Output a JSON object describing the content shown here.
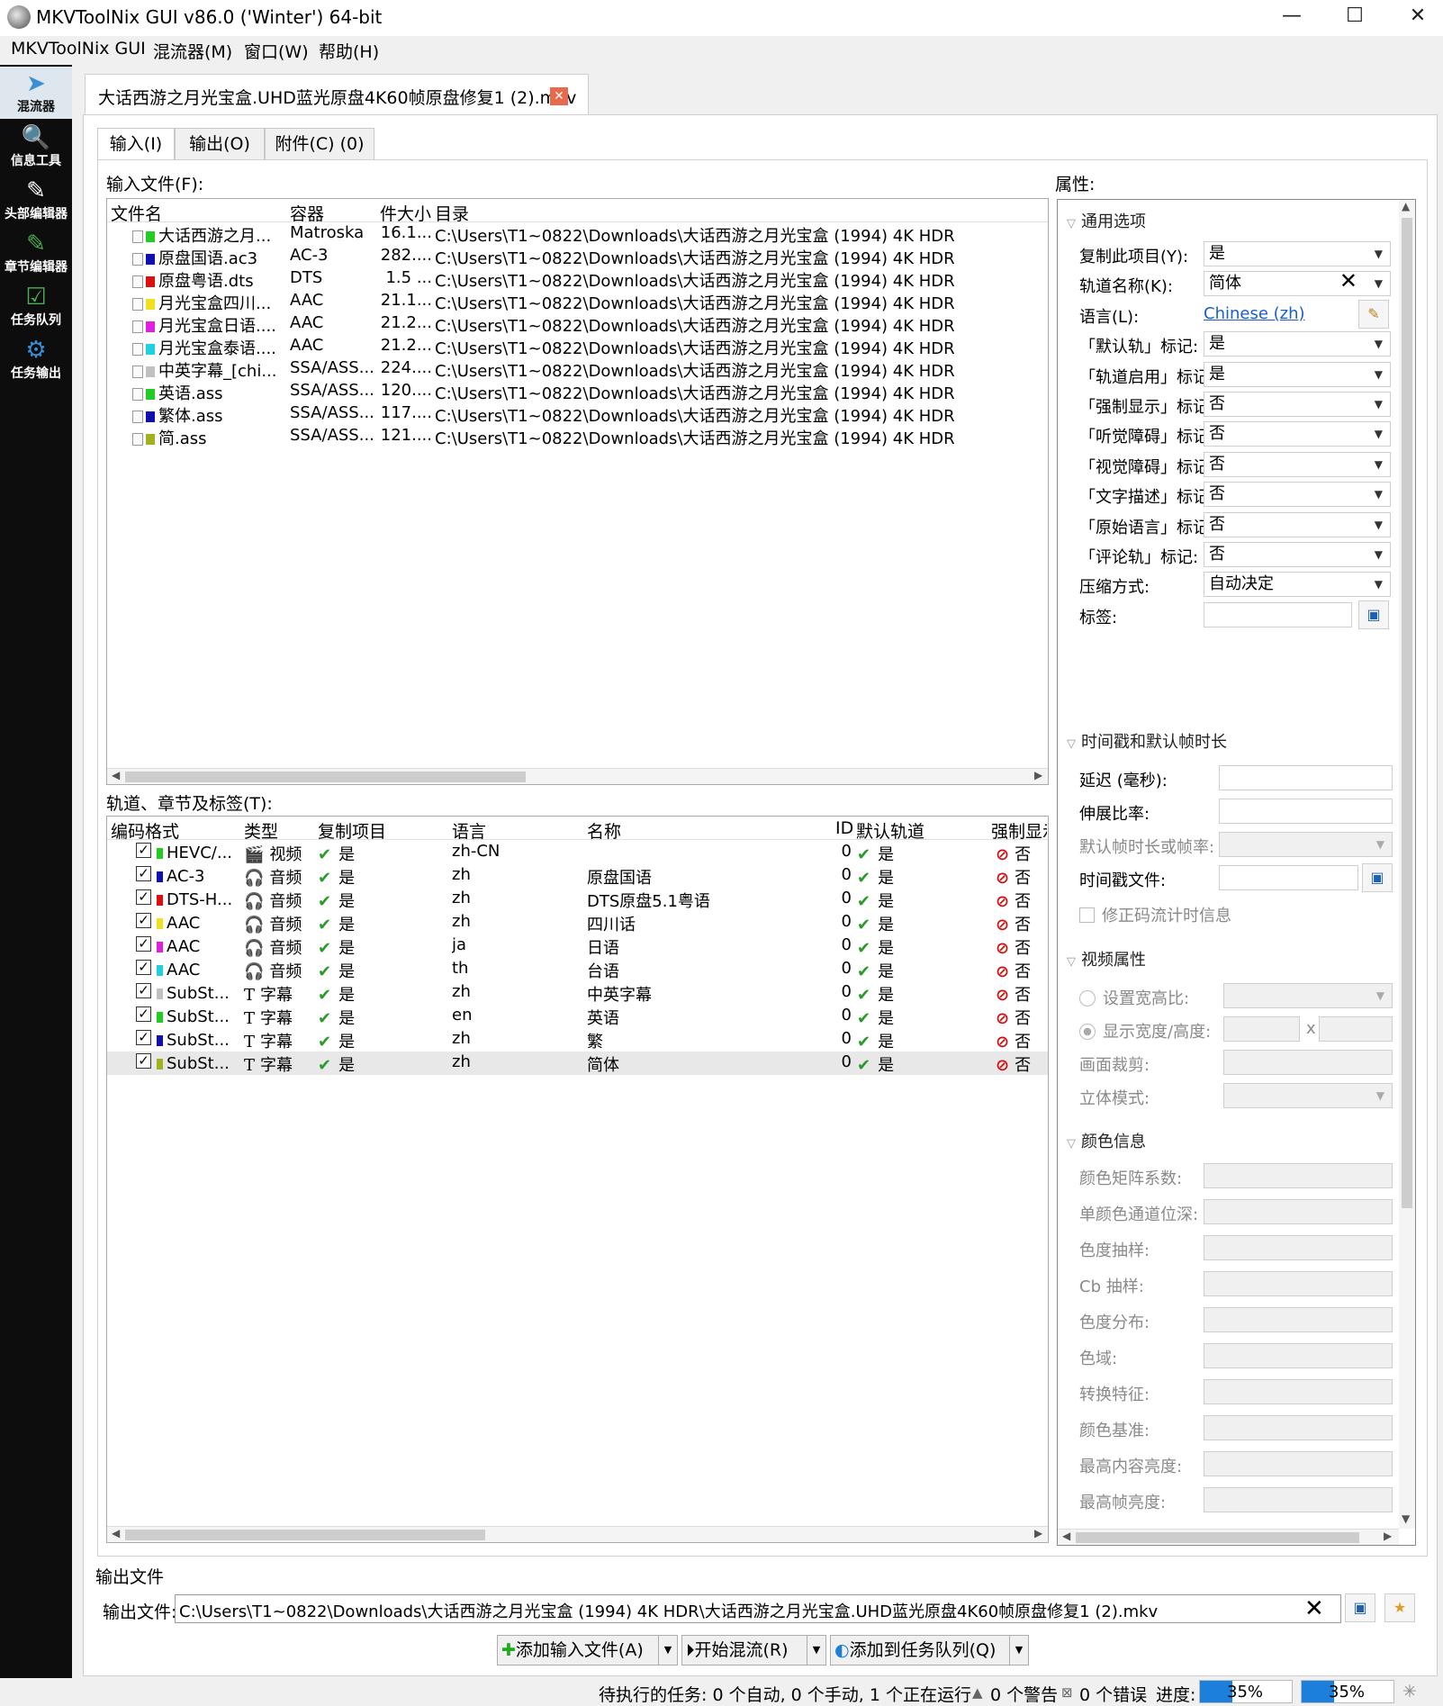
{
  "window": {
    "title": "MKVToolNix GUI v86.0 ('Winter') 64-bit",
    "min_glyph": "—",
    "max_glyph": "☐",
    "close_glyph": "✕"
  },
  "menu": [
    "MKVToolNix GUI",
    "混流器(M)",
    "窗口(W)",
    "帮助(H)"
  ],
  "sidebar": [
    {
      "label": "混流器",
      "icon": "mixer-icon"
    },
    {
      "label": "信息工具",
      "icon": "info-tool-icon"
    },
    {
      "label": "头部编辑器",
      "icon": "header-editor-icon"
    },
    {
      "label": "章节编辑器",
      "icon": "chapter-editor-icon"
    },
    {
      "label": "任务队列",
      "icon": "job-queue-icon"
    },
    {
      "label": "任务输出",
      "icon": "job-output-icon"
    }
  ],
  "doc_tab": {
    "label": "大话西游之月光宝盒.UHD蓝光原盘4K60帧原盘修复1 (2).mkv",
    "close": "✕"
  },
  "subtabs": [
    "输入(I)",
    "输出(O)",
    "附件(C) (0)"
  ],
  "input_files": {
    "label": "输入文件(F):",
    "headers": [
      "文件名",
      "容器",
      "件大小",
      "目录"
    ],
    "rows": [
      {
        "name": "大话西游之月...",
        "container": "Matroska",
        "size": "16.1...",
        "dir": "C:\\Users\\T1~0822\\Downloads\\大话西游之月光宝盒 (1994) 4K HDR",
        "color": "#22cc22"
      },
      {
        "name": "原盘国语.ac3",
        "container": "AC-3",
        "size": "282....",
        "dir": "C:\\Users\\T1~0822\\Downloads\\大话西游之月光宝盒 (1994) 4K HDR",
        "color": "#1010b0"
      },
      {
        "name": "原盘粤语.dts",
        "container": "DTS",
        "size": "1.5 ...",
        "dir": "C:\\Users\\T1~0822\\Downloads\\大话西游之月光宝盒 (1994) 4K HDR",
        "color": "#dd1010"
      },
      {
        "name": "月光宝盒四川...",
        "container": "AAC",
        "size": "21.1...",
        "dir": "C:\\Users\\T1~0822\\Downloads\\大话西游之月光宝盒 (1994) 4K HDR",
        "color": "#f0e020"
      },
      {
        "name": "月光宝盒日语....",
        "container": "AAC",
        "size": "21.2...",
        "dir": "C:\\Users\\T1~0822\\Downloads\\大话西游之月光宝盒 (1994) 4K HDR",
        "color": "#e020e0"
      },
      {
        "name": "月光宝盒泰语....",
        "container": "AAC",
        "size": "21.2...",
        "dir": "C:\\Users\\T1~0822\\Downloads\\大话西游之月光宝盒 (1994) 4K HDR",
        "color": "#20d0e0"
      },
      {
        "name": "中英字幕_[chi...",
        "container": "SSA/ASS...",
        "size": "224....",
        "dir": "C:\\Users\\T1~0822\\Downloads\\大话西游之月光宝盒 (1994) 4K HDR",
        "color": "#c0c0c0"
      },
      {
        "name": "英语.ass",
        "container": "SSA/ASS...",
        "size": "120....",
        "dir": "C:\\Users\\T1~0822\\Downloads\\大话西游之月光宝盒 (1994) 4K HDR",
        "color": "#22cc22"
      },
      {
        "name": "繁体.ass",
        "container": "SSA/ASS...",
        "size": "117....",
        "dir": "C:\\Users\\T1~0822\\Downloads\\大话西游之月光宝盒 (1994) 4K HDR",
        "color": "#1010b0"
      },
      {
        "name": "简.ass",
        "container": "SSA/ASS...",
        "size": "121....",
        "dir": "C:\\Users\\T1~0822\\Downloads\\大话西游之月光宝盒 (1994) 4K HDR",
        "color": "#a0b020"
      }
    ]
  },
  "tracks": {
    "label": "轨道、章节及标签(T):",
    "headers": [
      "编码格式",
      "类型",
      "复制项目",
      "语言",
      "名称",
      "ID",
      "默认轨道",
      "强制显示"
    ],
    "rows": [
      {
        "codec": "HEVC/...",
        "type": "视频",
        "type_icon": "video-icon",
        "copy": "是",
        "lang": "zh-CN",
        "name": "",
        "id": "0",
        "default": "是",
        "forced": "否",
        "color": "#22cc22"
      },
      {
        "codec": "AC-3",
        "type": "音频",
        "type_icon": "audio-icon",
        "copy": "是",
        "lang": "zh",
        "name": "原盘国语",
        "id": "0",
        "default": "是",
        "forced": "否",
        "color": "#1010b0"
      },
      {
        "codec": "DTS-H...",
        "type": "音频",
        "type_icon": "audio-icon",
        "copy": "是",
        "lang": "zh",
        "name": "DTS原盘5.1粤语",
        "id": "0",
        "default": "是",
        "forced": "否",
        "color": "#dd1010"
      },
      {
        "codec": "AAC",
        "type": "音频",
        "type_icon": "audio-icon",
        "copy": "是",
        "lang": "zh",
        "name": "四川话",
        "id": "0",
        "default": "是",
        "forced": "否",
        "color": "#f0e020"
      },
      {
        "codec": "AAC",
        "type": "音频",
        "type_icon": "audio-icon",
        "copy": "是",
        "lang": "ja",
        "name": "日语",
        "id": "0",
        "default": "是",
        "forced": "否",
        "color": "#e020e0"
      },
      {
        "codec": "AAC",
        "type": "音频",
        "type_icon": "audio-icon",
        "copy": "是",
        "lang": "th",
        "name": "台语",
        "id": "0",
        "default": "是",
        "forced": "否",
        "color": "#20d0e0"
      },
      {
        "codec": "SubSt...",
        "type": "字幕",
        "type_icon": "subtitle-icon",
        "copy": "是",
        "lang": "zh",
        "name": "中英字幕",
        "id": "0",
        "default": "是",
        "forced": "否",
        "color": "#c0c0c0"
      },
      {
        "codec": "SubSt...",
        "type": "字幕",
        "type_icon": "subtitle-icon",
        "copy": "是",
        "lang": "en",
        "name": "英语",
        "id": "0",
        "default": "是",
        "forced": "否",
        "color": "#22cc22"
      },
      {
        "codec": "SubSt...",
        "type": "字幕",
        "type_icon": "subtitle-icon",
        "copy": "是",
        "lang": "zh",
        "name": "繁",
        "id": "0",
        "default": "是",
        "forced": "否",
        "color": "#1010b0"
      },
      {
        "codec": "SubSt...",
        "type": "字幕",
        "type_icon": "subtitle-icon",
        "copy": "是",
        "lang": "zh",
        "name": "简体",
        "id": "0",
        "default": "是",
        "forced": "否",
        "color": "#a0b020"
      }
    ]
  },
  "properties": {
    "label": "属性:",
    "general_title": "通用选项",
    "general": [
      {
        "key": "复制此项目(Y):",
        "value": "是",
        "kind": "combo"
      },
      {
        "key": "轨道名称(K):",
        "value": "简体",
        "kind": "text-clear"
      },
      {
        "key": "语言(L):",
        "value": "Chinese (zh)",
        "kind": "link"
      },
      {
        "key": "「默认轨」标记:",
        "value": "是",
        "kind": "combo"
      },
      {
        "key": "「轨道启用」标记:",
        "value": "是",
        "kind": "combo"
      },
      {
        "key": "「强制显示」标记:",
        "value": "否",
        "kind": "combo"
      },
      {
        "key": "「听觉障碍」标记:",
        "value": "否",
        "kind": "combo"
      },
      {
        "key": "「视觉障碍」标记:",
        "value": "否",
        "kind": "combo"
      },
      {
        "key": "「文字描述」标记:",
        "value": "否",
        "kind": "combo"
      },
      {
        "key": "「原始语言」标记:",
        "value": "否",
        "kind": "combo"
      },
      {
        "key": "「评论轨」标记:",
        "value": "否",
        "kind": "combo"
      },
      {
        "key": "压缩方式:",
        "value": "自动决定",
        "kind": "combo"
      },
      {
        "key": "标签:",
        "value": "",
        "kind": "text-browse"
      }
    ],
    "timing_title": "时间戳和默认帧时长",
    "timing": {
      "delay": "延迟 (毫秒):",
      "stretch": "伸展比率:",
      "default_duration": "默认帧时长或帧率:",
      "timestamp_file": "时间戳文件:",
      "fix_bitstream": "修正码流计时信息"
    },
    "video_title": "视频属性",
    "video": {
      "aspect_ratio": "设置宽高比:",
      "display_wh": "显示宽度/高度:",
      "x": "x",
      "crop": "画面裁剪:",
      "stereo": "立体模式:"
    },
    "color_title": "颜色信息",
    "color": [
      "颜色矩阵系数:",
      "单颜色通道位深:",
      "色度抽样:",
      "Cb 抽样:",
      "色度分布:",
      "色域:",
      "转换特征:",
      "颜色基准:",
      "最高内容亮度:",
      "最高帧亮度:"
    ]
  },
  "output": {
    "group": "输出文件",
    "label": "输出文件:",
    "path": "C:\\Users\\T1~0822\\Downloads\\大话西游之月光宝盒 (1994) 4K HDR\\大话西游之月光宝盒.UHD蓝光原盘4K60帧原盘修复1 (2).mkv"
  },
  "actions": {
    "add_input": "添加输入文件(A)",
    "start_mux": "开始混流(R)",
    "add_queue": "添加到任务队列(Q)"
  },
  "status": {
    "pending": "待执行的任务: 0 个自动, 0 个手动, 1 个正在运行",
    "warnings": "0 个警告",
    "errors": "0 个错误",
    "progress_label": "进度:",
    "progress1": "35%",
    "progress2": "35%",
    "progress_value": 0.35
  }
}
